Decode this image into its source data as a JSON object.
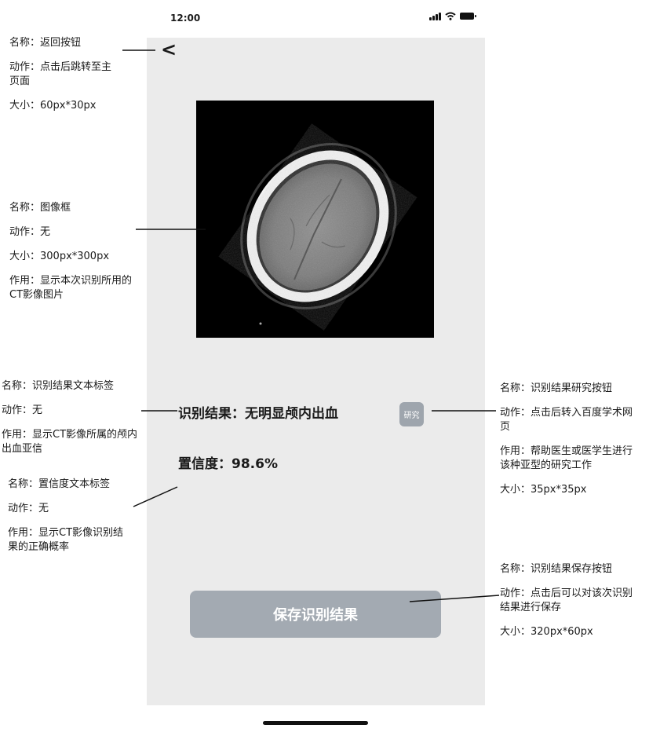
{
  "status_bar": {
    "time": "12:00"
  },
  "screen": {
    "back_label": "<",
    "result_text": "识别结果：无明显颅内出血",
    "research_label": "研究",
    "confidence_text": "置信度：98.6%",
    "save_label": "保存识别结果"
  },
  "colors": {
    "screen_background": "#ebebeb",
    "button_gray": "#a3aab2",
    "research_button_gray": "#9ea5ad"
  },
  "annotations": {
    "back_button": [
      "名称：返回按钮",
      "动作：点击后跳转至主页面",
      "大小：60px*30px"
    ],
    "image_frame": [
      "名称：图像框",
      "动作：无",
      "大小：300px*300px",
      "作用：显示本次识别所用的CT影像图片"
    ],
    "result_label": [
      "名称：识别结果文本标签",
      "动作：无",
      "作用：显示CT影像所属的颅内出血亚信"
    ],
    "confidence_label": [
      "名称：置信度文本标签",
      "动作：无",
      "作用：显示CT影像识别结果的正确概率"
    ],
    "research_button": [
      "名称：识别结果研究按钮",
      "动作：点击后转入百度学术网页",
      "作用：帮助医生或医学生进行该种亚型的研究工作",
      "大小：35px*35px"
    ],
    "save_button": [
      "名称：识别结果保存按钮",
      "动作：点击后可以对该次识别结果进行保存",
      "大小：320px*60px"
    ]
  },
  "icons": [
    "signal-icon",
    "wifi-icon",
    "battery-icon"
  ]
}
